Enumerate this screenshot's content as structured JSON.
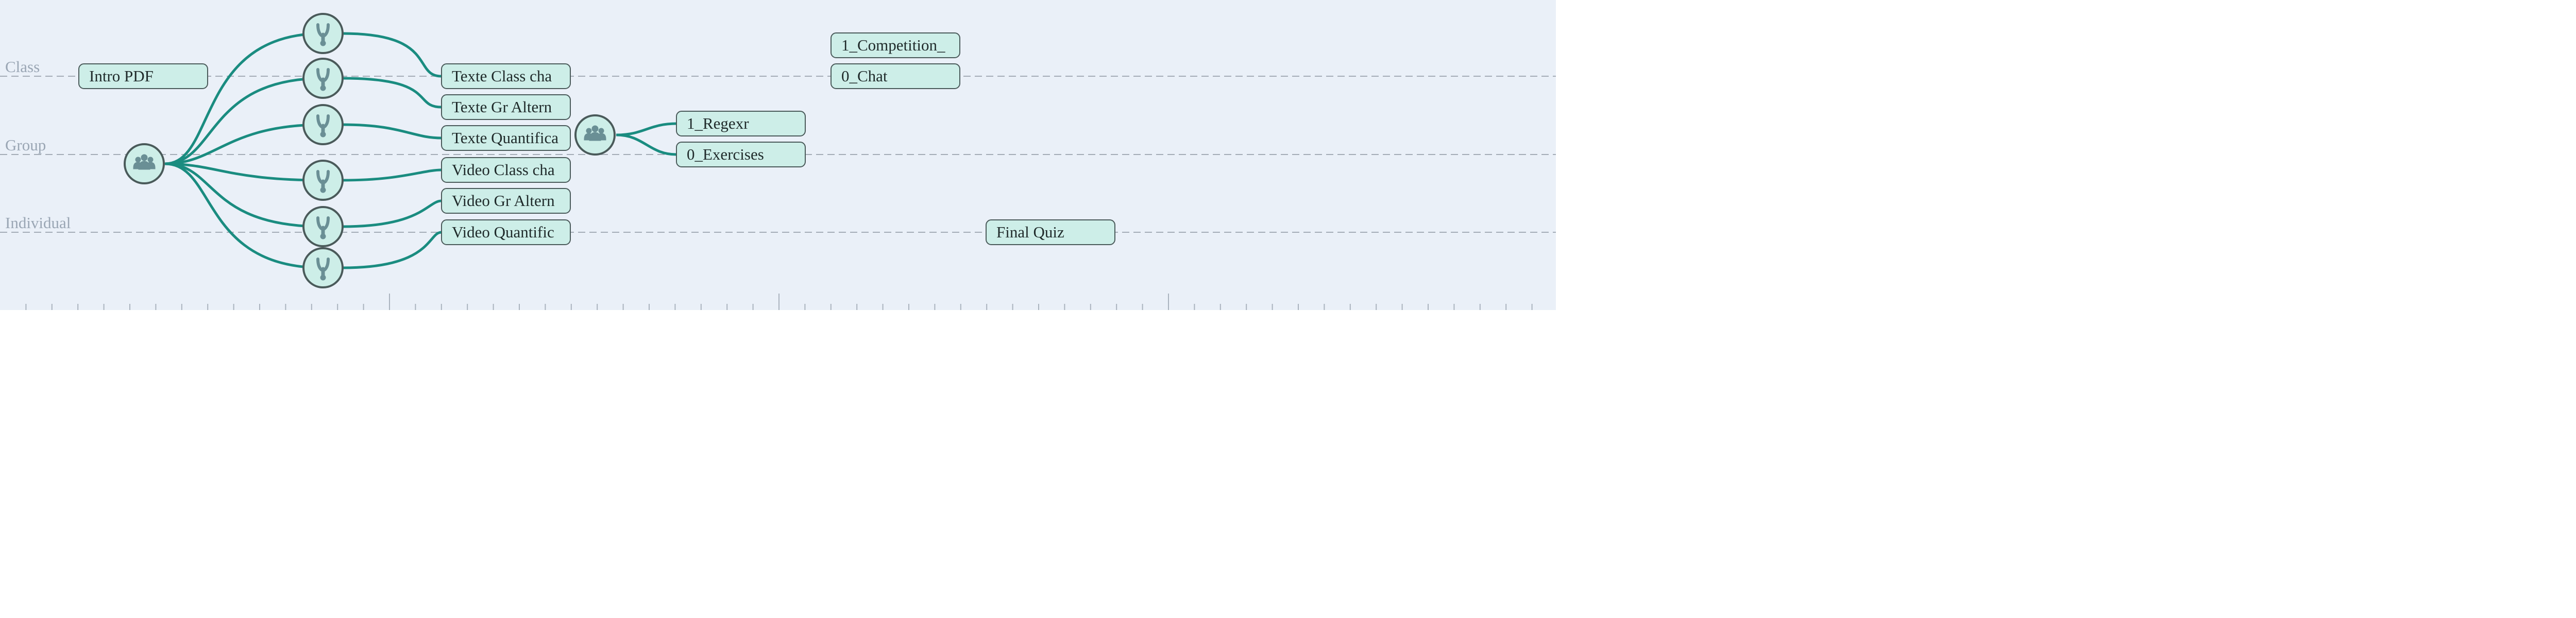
{
  "lanes": [
    {
      "id": "class",
      "label": "Class"
    },
    {
      "id": "group",
      "label": "Group"
    },
    {
      "id": "individual",
      "label": "Individual"
    }
  ],
  "activities": [
    {
      "id": "intro",
      "label": "Intro PDF",
      "lane": "class"
    },
    {
      "id": "texte-class",
      "label": "Texte Class cha",
      "lane": "class"
    },
    {
      "id": "texte-gr",
      "label": "Texte Gr Altern",
      "lane": "group"
    },
    {
      "id": "texte-quant",
      "label": "Texte Quantifica",
      "lane": "group"
    },
    {
      "id": "video-class",
      "label": "Video Class cha",
      "lane": "group"
    },
    {
      "id": "video-gr",
      "label": "Video Gr Altern",
      "lane": "individual"
    },
    {
      "id": "video-quant",
      "label": "Video Quantific",
      "lane": "individual"
    },
    {
      "id": "regexr",
      "label": "1_Regexr",
      "lane": "group"
    },
    {
      "id": "exercises",
      "label": "0_Exercises",
      "lane": "group"
    },
    {
      "id": "competition",
      "label": "1_Competition_",
      "lane": "class"
    },
    {
      "id": "chat",
      "label": "0_Chat",
      "lane": "class"
    },
    {
      "id": "final-quiz",
      "label": "Final Quiz",
      "lane": "individual"
    }
  ],
  "icons": {
    "group_node": "group-icon",
    "fork_node": "fork-icon"
  },
  "colors": {
    "background": "#eaf0f8",
    "node_fill": "#cdeee8",
    "node_stroke": "#4a5a5a",
    "connector": "#1a8c80",
    "lane_line": "#a4acb6",
    "lane_label": "#9aa6b4",
    "icon": "#6a8f95",
    "ruler": "#aab3be"
  }
}
